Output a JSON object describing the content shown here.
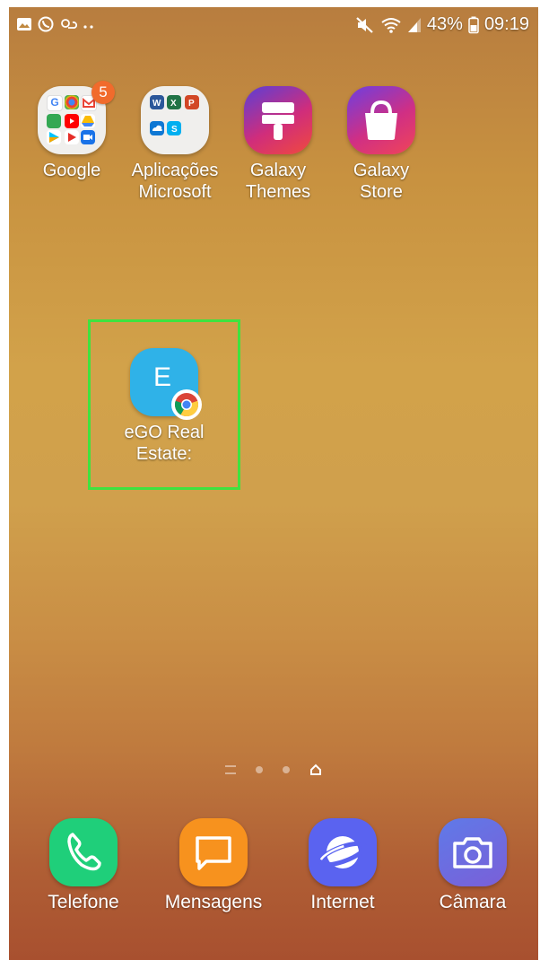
{
  "status_bar": {
    "battery": "43%",
    "time": "09:19",
    "left_icons": [
      "image-icon",
      "whatsapp-icon",
      "weather-icon",
      "more-dots-icon"
    ],
    "right_icons": [
      "mute-icon",
      "wifi-icon",
      "signal-icon",
      "battery-icon"
    ]
  },
  "apps": [
    {
      "label": "Google",
      "badge": "5",
      "type": "folder"
    },
    {
      "label": "Aplicações\nMicrosoft",
      "type": "folder"
    },
    {
      "label": "Galaxy\nThemes",
      "type": "app"
    },
    {
      "label": "Galaxy\nStore",
      "type": "app"
    }
  ],
  "ego_app": {
    "letter": "E",
    "label": "eGO Real\nEstate:"
  },
  "dock": [
    {
      "label": "Telefone"
    },
    {
      "label": "Mensagens"
    },
    {
      "label": "Internet"
    },
    {
      "label": "Câmara"
    }
  ],
  "colors": {
    "selection": "#3fe23f",
    "phone": "#1fcf7a",
    "messages": "#f7921e",
    "internet": "#5a63f0",
    "camera": "#5e6ee0",
    "ego": "#2fb2e8"
  }
}
